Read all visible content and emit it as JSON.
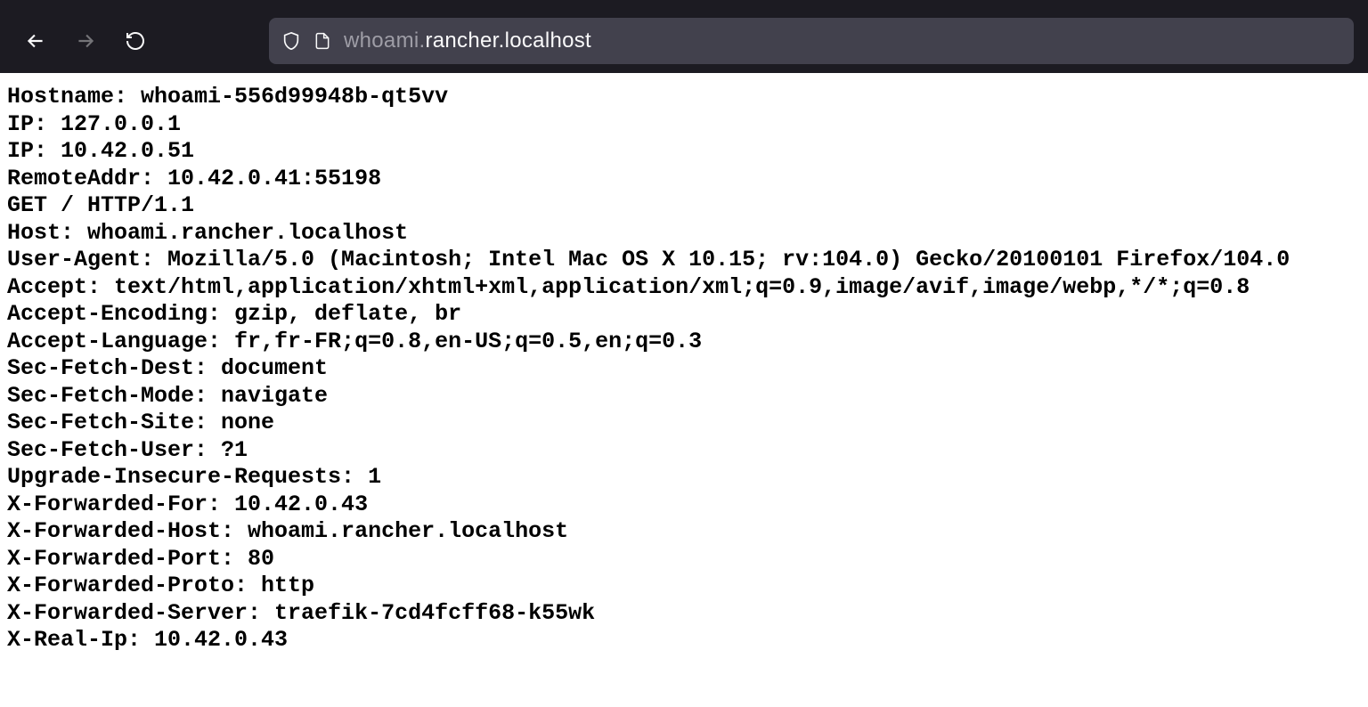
{
  "url": {
    "subdomain": "whoami.",
    "domain": "rancher.localhost"
  },
  "response": {
    "lines": [
      "Hostname: whoami-556d99948b-qt5vv",
      "IP: 127.0.0.1",
      "IP: 10.42.0.51",
      "RemoteAddr: 10.42.0.41:55198",
      "GET / HTTP/1.1",
      "Host: whoami.rancher.localhost",
      "User-Agent: Mozilla/5.0 (Macintosh; Intel Mac OS X 10.15; rv:104.0) Gecko/20100101 Firefox/104.0",
      "Accept: text/html,application/xhtml+xml,application/xml;q=0.9,image/avif,image/webp,*/*;q=0.8",
      "Accept-Encoding: gzip, deflate, br",
      "Accept-Language: fr,fr-FR;q=0.8,en-US;q=0.5,en;q=0.3",
      "Sec-Fetch-Dest: document",
      "Sec-Fetch-Mode: navigate",
      "Sec-Fetch-Site: none",
      "Sec-Fetch-User: ?1",
      "Upgrade-Insecure-Requests: 1",
      "X-Forwarded-For: 10.42.0.43",
      "X-Forwarded-Host: whoami.rancher.localhost",
      "X-Forwarded-Port: 80",
      "X-Forwarded-Proto: http",
      "X-Forwarded-Server: traefik-7cd4fcff68-k55wk",
      "X-Real-Ip: 10.42.0.43"
    ]
  }
}
